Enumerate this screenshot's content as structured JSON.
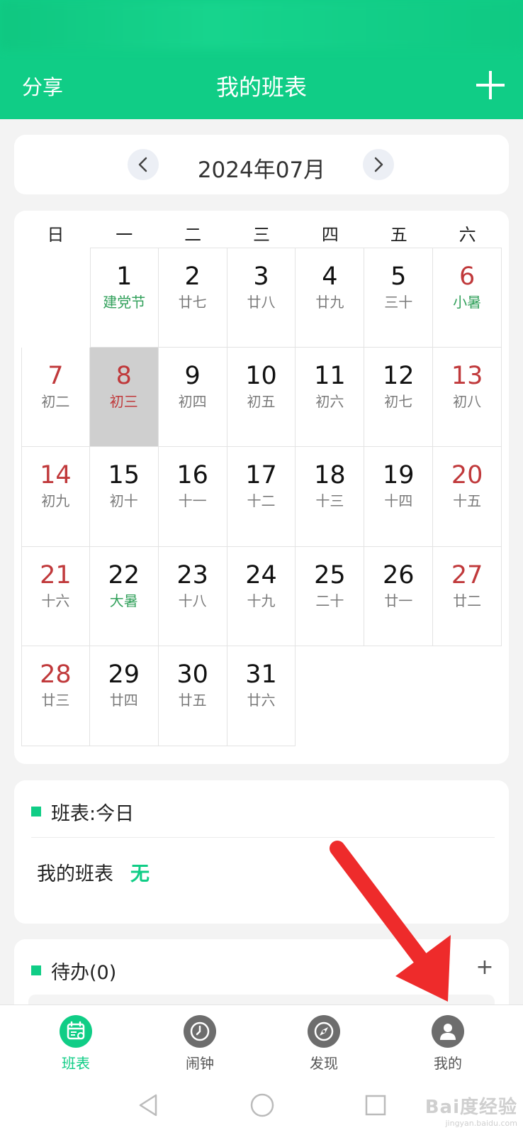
{
  "header": {
    "share_label": "分享",
    "title": "我的班表",
    "add_icon": "plus-icon",
    "color": "#10cd86"
  },
  "month_nav": {
    "label": "2024年07月",
    "prev_icon": "chevron-left-icon",
    "next_icon": "chevron-right-icon"
  },
  "calendar": {
    "weekdays": [
      "日",
      "一",
      "二",
      "三",
      "四",
      "五",
      "六"
    ],
    "selected_day": "8",
    "days": [
      {
        "day": "1",
        "lunar": "建党节",
        "lunar_color": "green"
      },
      {
        "day": "2",
        "lunar": "廿七"
      },
      {
        "day": "3",
        "lunar": "廿八"
      },
      {
        "day": "4",
        "lunar": "廿九"
      },
      {
        "day": "5",
        "lunar": "三十"
      },
      {
        "day": "6",
        "lunar": "小暑",
        "lunar_color": "green"
      },
      {
        "day": "7",
        "lunar": "初二"
      },
      {
        "day": "8",
        "lunar": "初三",
        "lunar_color": "red"
      },
      {
        "day": "9",
        "lunar": "初四"
      },
      {
        "day": "10",
        "lunar": "初五"
      },
      {
        "day": "11",
        "lunar": "初六"
      },
      {
        "day": "12",
        "lunar": "初七"
      },
      {
        "day": "13",
        "lunar": "初八"
      },
      {
        "day": "14",
        "lunar": "初九"
      },
      {
        "day": "15",
        "lunar": "初十"
      },
      {
        "day": "16",
        "lunar": "十一"
      },
      {
        "day": "17",
        "lunar": "十二"
      },
      {
        "day": "18",
        "lunar": "十三"
      },
      {
        "day": "19",
        "lunar": "十四"
      },
      {
        "day": "20",
        "lunar": "十五"
      },
      {
        "day": "21",
        "lunar": "十六"
      },
      {
        "day": "22",
        "lunar": "大暑",
        "lunar_color": "green"
      },
      {
        "day": "23",
        "lunar": "十八"
      },
      {
        "day": "24",
        "lunar": "十九"
      },
      {
        "day": "25",
        "lunar": "二十"
      },
      {
        "day": "26",
        "lunar": "廿一"
      },
      {
        "day": "27",
        "lunar": "廿二"
      },
      {
        "day": "28",
        "lunar": "廿三"
      },
      {
        "day": "29",
        "lunar": "廿四"
      },
      {
        "day": "30",
        "lunar": "廿五"
      },
      {
        "day": "31",
        "lunar": "廿六"
      }
    ],
    "weekend_color": "#c0393b",
    "holiday_color": "#33a15c"
  },
  "today_section": {
    "heading": "班表:今日",
    "row_label": "我的班表",
    "row_value": "无"
  },
  "todo_section": {
    "heading": "待办(0)",
    "add_label": "+"
  },
  "tabbar": {
    "items": [
      {
        "label": "班表",
        "icon": "calendar-icon",
        "active": true
      },
      {
        "label": "闹钟",
        "icon": "clock-icon",
        "active": false
      },
      {
        "label": "发现",
        "icon": "compass-icon",
        "active": false
      },
      {
        "label": "我的",
        "icon": "user-icon",
        "active": false
      }
    ]
  },
  "system_nav": {
    "icons": [
      "back-triangle-icon",
      "home-circle-icon",
      "recents-square-icon"
    ]
  },
  "watermark": {
    "main": "Bai度经验",
    "sub": "jingyan.baidu.com"
  }
}
